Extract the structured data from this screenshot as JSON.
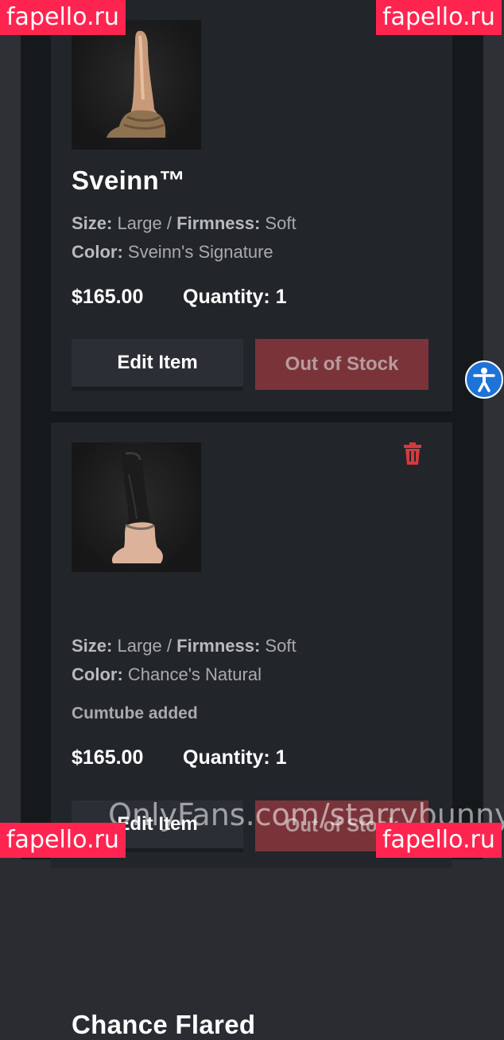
{
  "cart": {
    "items": [
      {
        "name": "Sveinn™",
        "size_label": "Size:",
        "size": "Large",
        "separator": "/",
        "firmness_label": "Firmness:",
        "firmness": "Soft",
        "color_label": "Color:",
        "color": "Sveinn's Signature",
        "price": "$165.00",
        "quantity": "Quantity: 1",
        "edit_label": "Edit Item",
        "stock_label": "Out of Stock"
      },
      {
        "name": "Chance Flared",
        "size_label": "Size:",
        "size": "Large",
        "separator": "/",
        "firmness_label": "Firmness:",
        "firmness": "Soft",
        "color_label": "Color:",
        "color": "Chance's Natural",
        "extra": "Cumtube added",
        "price": "$165.00",
        "quantity": "Quantity: 1",
        "edit_label": "Edit Item",
        "stock_label": "Out of Stock"
      }
    ]
  },
  "icons": {
    "delete": "trash-icon",
    "accessibility": "accessibility-icon"
  },
  "colors": {
    "delete": "#d63a3f",
    "out_of_stock": "#7a3439",
    "accessibility": "#1d73d8",
    "watermark": "#ff2550"
  },
  "watermarks": {
    "site": "fapello.ru",
    "overlay": "OnlyFans.com/starrybunny"
  }
}
